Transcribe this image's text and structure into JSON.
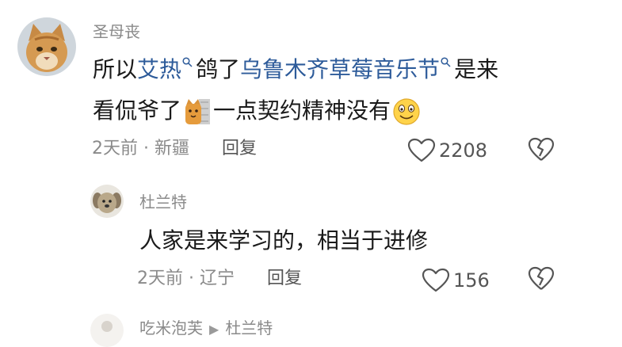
{
  "comments": [
    {
      "user": "圣母丧",
      "text": {
        "p1": "所以",
        "link1": "艾热",
        "p2": "鸽了",
        "link2": "乌鲁木齐草莓音乐节",
        "p3": "是来",
        "p4": "看侃爷了",
        "p5": "一点契约精神没有"
      },
      "time": "2天前",
      "location": "新疆",
      "reply_label": "回复",
      "likes": "2208"
    },
    {
      "user": "杜兰特",
      "text": "人家是来学习的，相当于进修",
      "time": "2天前",
      "location": "辽宁",
      "reply_label": "回复",
      "likes": "156"
    },
    {
      "user": "吃米泡芙",
      "reply_to": "杜兰特"
    }
  ],
  "separator": "·",
  "colors": {
    "link": "#2d5b9a",
    "meta": "#8a8a8a",
    "text": "#1a1a1a"
  },
  "icons": [
    "search-icon",
    "cat-emoji-icon",
    "smile-emoji-icon",
    "heart-icon",
    "broken-heart-icon",
    "play-triangle-icon"
  ]
}
